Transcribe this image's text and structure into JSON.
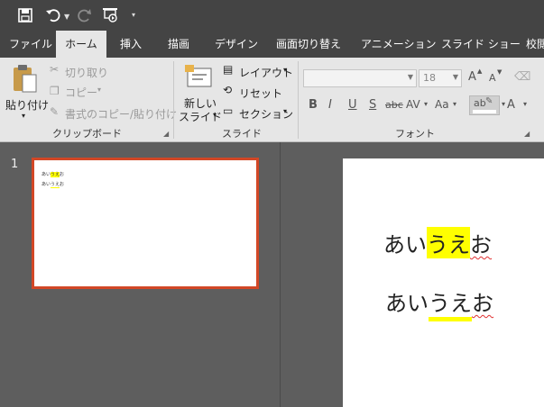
{
  "qat": {
    "icons": [
      "save-icon",
      "undo-icon",
      "redo-icon",
      "start-presentation-icon",
      "customize-qat-icon"
    ]
  },
  "tabs": [
    {
      "label": "ファイル"
    },
    {
      "label": "ホーム"
    },
    {
      "label": "挿入"
    },
    {
      "label": "描画"
    },
    {
      "label": "デザイン"
    },
    {
      "label": "画面切り替え"
    },
    {
      "label": "アニメーション"
    },
    {
      "label": "スライド ショー"
    },
    {
      "label": "校閲"
    }
  ],
  "clipboard": {
    "paste": "貼り付け",
    "cut": "切り取り",
    "copy": "コピー",
    "format_painter": "書式のコピー/貼り付け",
    "group": "クリップボード"
  },
  "slides_group": {
    "new_slide_1": "新しい",
    "new_slide_2": "スライド",
    "layout": "レイアウト",
    "reset": "リセット",
    "section": "セクション",
    "group": "スライド"
  },
  "font": {
    "font_name": "",
    "font_size": "18",
    "grow": "A",
    "shrink": "A",
    "bold": "B",
    "italic": "I",
    "underline": "U",
    "shadow": "S",
    "strike": "abc",
    "spacing": "AV",
    "case": "Aa",
    "highlight": "ab",
    "color": "A",
    "group": "フォント"
  },
  "thumbnail": {
    "number": "1",
    "line1": {
      "a": "あい",
      "b": "うえ",
      "c": "お"
    },
    "line2": {
      "a": "あい",
      "b": "うえ",
      "c": "お"
    }
  },
  "slide": {
    "line1": {
      "a": "あい",
      "b": "うえ",
      "c": "お"
    },
    "line2": {
      "a": "あい",
      "b": "うえ",
      "c": "お"
    }
  },
  "colors": {
    "title_bar": "#444444",
    "ribbon": "#e6e6e6",
    "selection_border": "#d24726",
    "highlight": "#ffff00",
    "workspace": "#5e5e5e"
  }
}
